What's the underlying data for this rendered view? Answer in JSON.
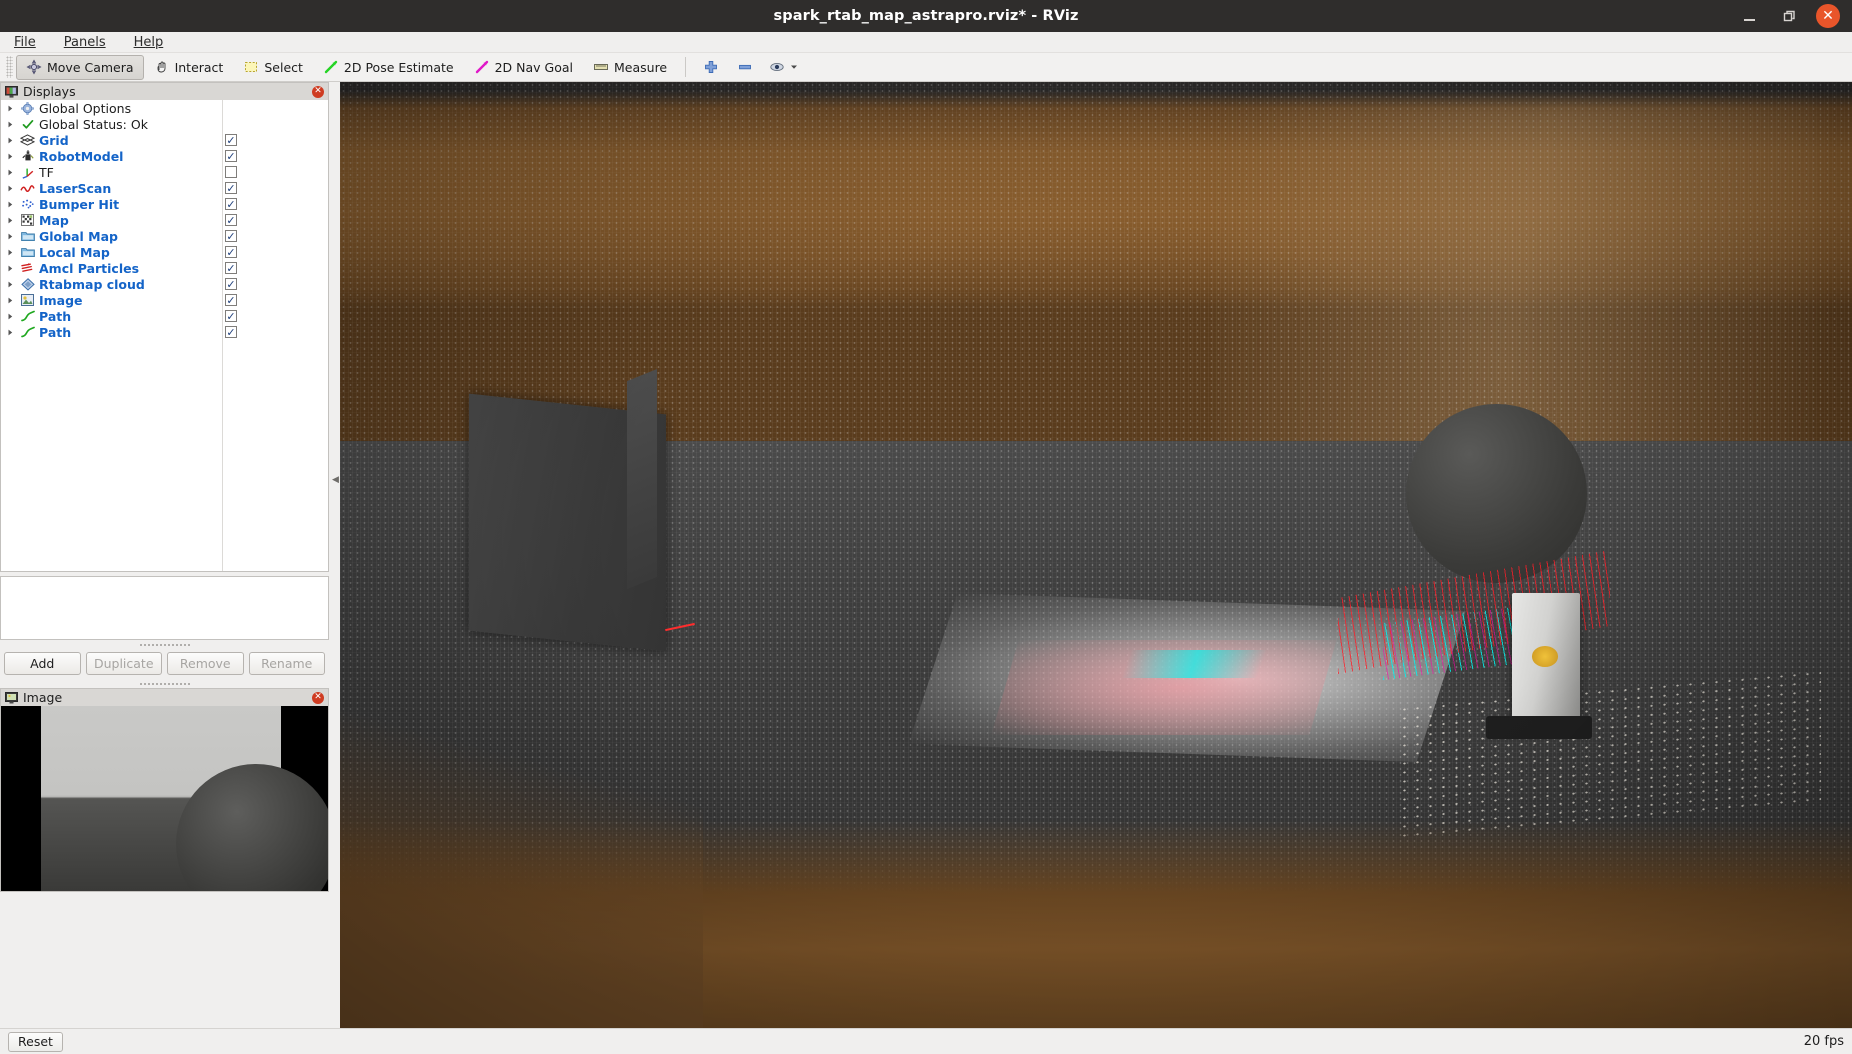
{
  "window": {
    "title": "spark_rtab_map_astrapro.rviz* - RViz",
    "minimize_label": "",
    "maximize_label": "",
    "close_label": "✕"
  },
  "menubar": {
    "items": [
      {
        "label": "File",
        "mnemonic": "F"
      },
      {
        "label": "Panels",
        "mnemonic": "P"
      },
      {
        "label": "Help",
        "mnemonic": "H"
      }
    ]
  },
  "toolbar": {
    "tools": [
      {
        "label": "Move Camera",
        "icon": "move-camera-icon",
        "active": true
      },
      {
        "label": "Interact",
        "icon": "interact-hand-icon",
        "active": false
      },
      {
        "label": "Select",
        "icon": "select-rect-icon",
        "active": false
      },
      {
        "label": "2D Pose Estimate",
        "icon": "pose-estimate-arrow-icon",
        "active": false
      },
      {
        "label": "2D Nav Goal",
        "icon": "nav-goal-arrow-icon",
        "active": false
      },
      {
        "label": "Measure",
        "icon": "ruler-icon",
        "active": false
      }
    ],
    "extra_icons": [
      {
        "name": "plus-icon",
        "label": "+"
      },
      {
        "name": "minus-icon",
        "label": "−"
      },
      {
        "name": "focus-eye-icon",
        "label": "◉"
      }
    ]
  },
  "displays_panel": {
    "title": "Displays",
    "close_label": "✕",
    "items": [
      {
        "label": "Global Options",
        "icon": "gear-icon",
        "link": false,
        "checkbox": null
      },
      {
        "label": "Global Status: Ok",
        "icon": "checkmark-icon",
        "link": false,
        "checkbox": null
      },
      {
        "label": "Grid",
        "icon": "grid-icon",
        "link": true,
        "checkbox": true
      },
      {
        "label": "RobotModel",
        "icon": "robot-icon",
        "link": true,
        "checkbox": true
      },
      {
        "label": "TF",
        "icon": "tf-axes-icon",
        "link": false,
        "checkbox": false
      },
      {
        "label": "LaserScan",
        "icon": "laserscan-icon",
        "link": true,
        "checkbox": true
      },
      {
        "label": "Bumper Hit",
        "icon": "pointcloud-icon",
        "link": true,
        "checkbox": true
      },
      {
        "label": "Map",
        "icon": "map-icon",
        "link": true,
        "checkbox": true
      },
      {
        "label": "Global Map",
        "icon": "folder-icon",
        "link": true,
        "checkbox": true
      },
      {
        "label": "Local Map",
        "icon": "folder-icon",
        "link": true,
        "checkbox": true
      },
      {
        "label": "Amcl Particles",
        "icon": "pose-array-icon",
        "link": true,
        "checkbox": true
      },
      {
        "label": "Rtabmap cloud",
        "icon": "cloud-diamond-icon",
        "link": true,
        "checkbox": true
      },
      {
        "label": "Image",
        "icon": "image-icon",
        "link": true,
        "checkbox": true
      },
      {
        "label": "Path",
        "icon": "path-icon",
        "link": true,
        "checkbox": true
      },
      {
        "label": "Path",
        "icon": "path-icon",
        "link": true,
        "checkbox": true
      }
    ],
    "buttons": [
      {
        "label": "Add",
        "enabled": true
      },
      {
        "label": "Duplicate",
        "enabled": false
      },
      {
        "label": "Remove",
        "enabled": false
      },
      {
        "label": "Rename",
        "enabled": false
      }
    ],
    "checkmark_glyph": "✓"
  },
  "image_panel": {
    "title": "Image",
    "close_label": "✕"
  },
  "statusbar": {
    "reset_label": "Reset",
    "fps": "20 fps"
  },
  "colors": {
    "titlebar_bg": "#2f2d2c",
    "close_button": "#e9552a",
    "tree_link": "#1464c8",
    "checkbox_mark": "#20407c",
    "panel_bg": "#f0efee",
    "view_bg": "#303030"
  }
}
